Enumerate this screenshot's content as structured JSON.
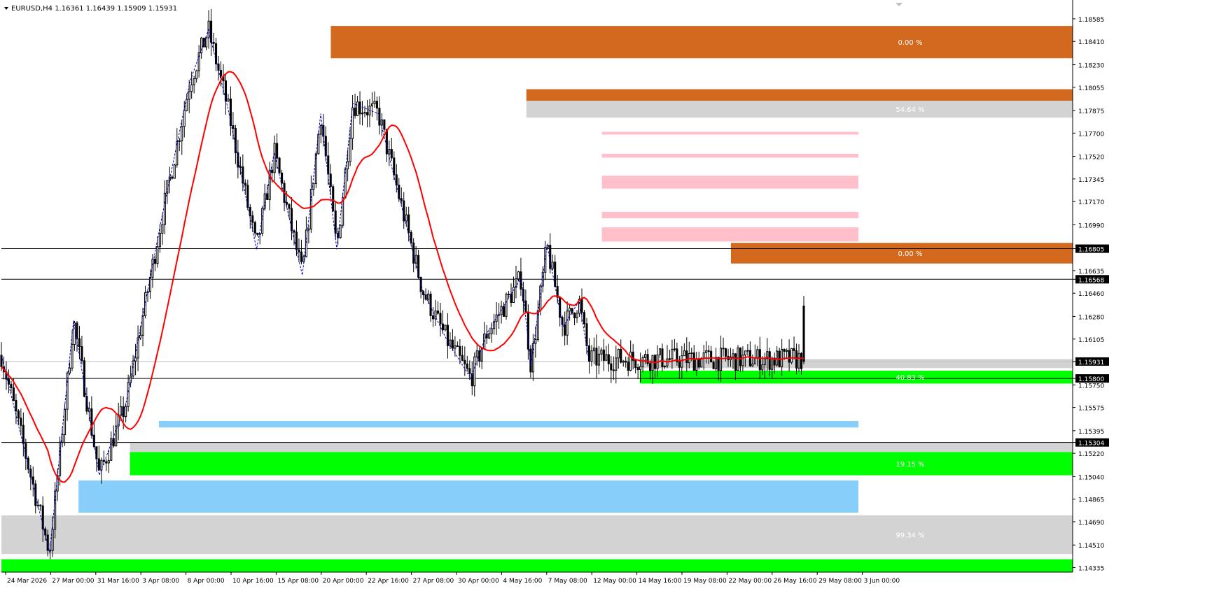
{
  "header": {
    "symbol_line": "EURUSD,H4  1.16361 1.16439 1.15909 1.15931"
  },
  "colors": {
    "background": "#ffffff",
    "candle": "#000000",
    "ma": "#ff0000",
    "zigzag": "#0000cc",
    "zone_orange": "#d2691e",
    "zone_gray": "#d3d3d3",
    "zone_pink": "#ffc0cb",
    "zone_green": "#00ff00",
    "zone_blue": "#87cefa",
    "price_line": "#000000",
    "bid_line": "#c0c0c0"
  },
  "chart_data": {
    "type": "candlestick",
    "symbol": "EURUSD",
    "timeframe": "H4",
    "last_ohlc": {
      "open": 1.16361,
      "high": 1.16439,
      "low": 1.15909,
      "close": 1.15931
    },
    "ylim": [
      1.143,
      1.1872
    ],
    "y_ticks": [
      "1.18585",
      "1.18410",
      "1.18230",
      "1.18055",
      "1.17875",
      "1.17700",
      "1.17520",
      "1.17345",
      "1.17170",
      "1.16990",
      "1.16805",
      "1.16635",
      "1.16568",
      "1.16460",
      "1.16280",
      "1.16105",
      "1.15931",
      "1.15800",
      "1.15750",
      "1.15575",
      "1.15395",
      "1.15304",
      "1.15220",
      "1.15040",
      "1.14865",
      "1.14690",
      "1.14510",
      "1.14335"
    ],
    "x_ticks": [
      "24 Mar 2026",
      "27 Mar 00:00",
      "31 Mar 16:00",
      "3 Apr 08:00",
      "8 Apr 00:00",
      "10 Apr 16:00",
      "15 Apr 08:00",
      "20 Apr 00:00",
      "22 Apr 16:00",
      "27 Apr 08:00",
      "30 Apr 00:00",
      "4 May 16:00",
      "7 May 08:00",
      "12 May 00:00",
      "14 May 16:00",
      "19 May 08:00",
      "22 May 00:00",
      "26 May 16:00",
      "29 May 08:00",
      "3 Jun 00:00"
    ],
    "price_levels": [
      1.16805,
      1.16568,
      1.158,
      1.15304
    ],
    "bid_price": 1.15931,
    "highlighted_prices": [
      "1.16805",
      "1.16568",
      "1.15931",
      "1.15800",
      "1.15304"
    ],
    "zones": [
      {
        "color": "orange",
        "from_bar": 0.3075,
        "to_bar": 1.0,
        "low": 1.1828,
        "high": 1.1853,
        "label": "0.00 %"
      },
      {
        "color": "orange",
        "from_bar": 0.49,
        "to_bar": 1.0,
        "low": 1.1795,
        "high": 1.1804,
        "label": ""
      },
      {
        "color": "gray",
        "from_bar": 0.49,
        "to_bar": 1.0,
        "low": 1.1782,
        "high": 1.1795,
        "label": "54.64 %"
      },
      {
        "color": "pink",
        "from_bar": 0.5605,
        "to_bar": 0.8,
        "low": 1.17688,
        "high": 1.1771,
        "label": ""
      },
      {
        "color": "pink",
        "from_bar": 0.5605,
        "to_bar": 0.8,
        "low": 1.1751,
        "high": 1.1754,
        "label": ""
      },
      {
        "color": "pink",
        "from_bar": 0.5605,
        "to_bar": 0.8,
        "low": 1.1727,
        "high": 1.1737,
        "label": ""
      },
      {
        "color": "pink",
        "from_bar": 0.5605,
        "to_bar": 0.8,
        "low": 1.1704,
        "high": 1.1709,
        "label": ""
      },
      {
        "color": "pink",
        "from_bar": 0.5605,
        "to_bar": 0.8,
        "low": 1.1686,
        "high": 1.1697,
        "label": ""
      },
      {
        "color": "orange",
        "from_bar": 0.681,
        "to_bar": 1.0,
        "low": 1.1669,
        "high": 1.1685,
        "label": "0.00 %"
      },
      {
        "color": "gray",
        "from_bar": 0.596,
        "to_bar": 1.0,
        "low": 1.1588,
        "high": 1.1595,
        "label": ""
      },
      {
        "color": "green",
        "from_bar": 0.596,
        "to_bar": 1.0,
        "low": 1.1576,
        "high": 1.1586,
        "label": "40.83 %"
      },
      {
        "color": "blue",
        "from_bar": 0.147,
        "to_bar": 0.8,
        "low": 1.1542,
        "high": 1.1547,
        "label": ""
      },
      {
        "color": "gray",
        "from_bar": 0.12,
        "to_bar": 1.0,
        "low": 1.1523,
        "high": 1.153,
        "label": ""
      },
      {
        "color": "green",
        "from_bar": 0.12,
        "to_bar": 1.0,
        "low": 1.1505,
        "high": 1.1523,
        "label": "19.15 %"
      },
      {
        "color": "blue",
        "from_bar": 0.072,
        "to_bar": 0.8,
        "low": 1.1476,
        "high": 1.1501,
        "label": ""
      },
      {
        "color": "gray",
        "from_bar": 0.0,
        "to_bar": 1.0,
        "low": 1.1444,
        "high": 1.1474,
        "label": "99.34 %"
      },
      {
        "color": "green",
        "from_bar": 0.0,
        "to_bar": 1.0,
        "low": 1.143,
        "high": 1.144,
        "label": ""
      }
    ],
    "key_points": [
      {
        "bar": 0.0,
        "price": 1.1598
      },
      {
        "bar": 0.06,
        "price": 1.1445
      },
      {
        "bar": 0.09,
        "price": 1.1625
      },
      {
        "bar": 0.122,
        "price": 1.1505
      },
      {
        "bar": 0.155,
        "price": 1.156
      },
      {
        "bar": 0.2,
        "price": 1.1705
      },
      {
        "bar": 0.235,
        "price": 1.181
      },
      {
        "bar": 0.258,
        "price": 1.185
      },
      {
        "bar": 0.282,
        "price": 1.179
      },
      {
        "bar": 0.318,
        "price": 1.168
      },
      {
        "bar": 0.34,
        "price": 1.1755
      },
      {
        "bar": 0.375,
        "price": 1.166
      },
      {
        "bar": 0.398,
        "price": 1.1785
      },
      {
        "bar": 0.418,
        "price": 1.168
      },
      {
        "bar": 0.438,
        "price": 1.1793
      },
      {
        "bar": 0.47,
        "price": 1.1785
      },
      {
        "bar": 0.49,
        "price": 1.1735
      },
      {
        "bar": 0.525,
        "price": 1.1648
      },
      {
        "bar": 0.555,
        "price": 1.161
      },
      {
        "bar": 0.585,
        "price": 1.158
      },
      {
        "bar": 0.605,
        "price": 1.1615
      },
      {
        "bar": 0.648,
        "price": 1.1658
      },
      {
        "bar": 0.66,
        "price": 1.159
      },
      {
        "bar": 0.68,
        "price": 1.1683
      },
      {
        "bar": 0.7,
        "price": 1.162
      },
      {
        "bar": 0.72,
        "price": 1.164
      },
      {
        "bar": 0.732,
        "price": 1.1595
      }
    ]
  }
}
